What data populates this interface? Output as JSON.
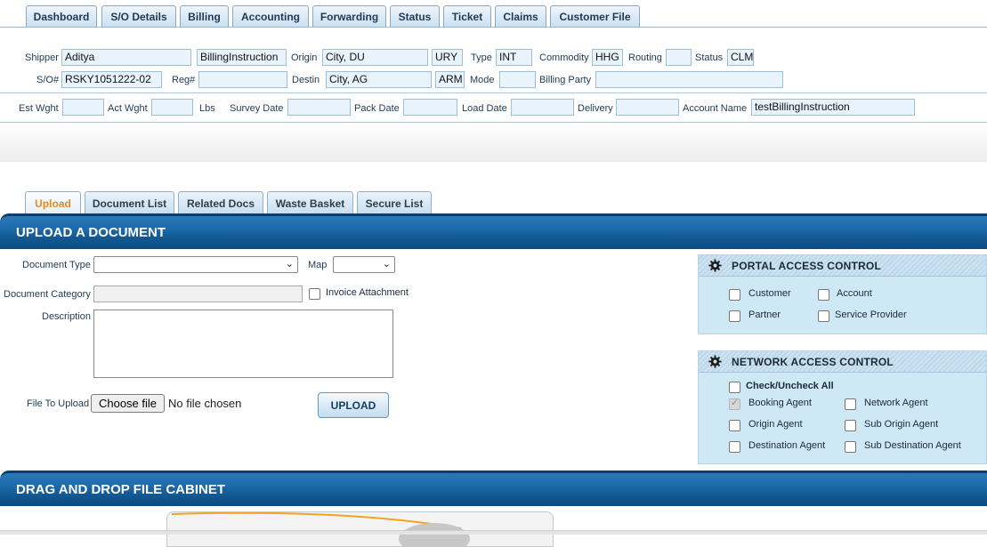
{
  "top_tabs": [
    "Dashboard",
    "S/O Details",
    "Billing",
    "Accounting",
    "Forwarding",
    "Status",
    "Ticket",
    "Claims",
    "Customer File"
  ],
  "header": {
    "shipper_label": "Shipper",
    "shipper_value": "Aditya",
    "billing_value": "BillingInstruction",
    "origin_label": "Origin",
    "origin_city": "City, DU",
    "origin_code": "URY",
    "type_label": "Type",
    "type_value": "INT",
    "commodity_label": "Commodity",
    "commodity_value": "HHG",
    "routing_label": "Routing",
    "routing_value": "",
    "status_label": "Status",
    "status_value": "CLM",
    "so_label": "S/O#",
    "so_value": "RSKY1051222-02",
    "reg_label": "Reg#",
    "reg_value": "",
    "destin_label": "Destin",
    "destin_city": "City, AG",
    "destin_code": "ARM",
    "mode_label": "Mode",
    "mode_value": "",
    "billing_party_label": "Billing Party",
    "billing_party_value": "",
    "est_wght_label": "Est Wght",
    "est_wght_value": "",
    "act_wght_label": "Act Wght",
    "act_wght_value": "",
    "lbs_label": "Lbs",
    "survey_date_label": "Survey Date",
    "survey_date_value": "",
    "pack_date_label": "Pack Date",
    "pack_date_value": "",
    "load_date_label": "Load Date",
    "load_date_value": "",
    "delivery_label": "Delivery",
    "delivery_value": "",
    "account_name_label": "Account Name",
    "account_name_value": "testBillingInstruction"
  },
  "doc_tabs": [
    "Upload",
    "Document List",
    "Related Docs",
    "Waste Basket",
    "Secure List"
  ],
  "upload_section": {
    "title": "UPLOAD A DOCUMENT",
    "document_type_label": "Document Type",
    "document_type_value": "",
    "map_label": "Map",
    "map_value": "",
    "document_category_label": "Document Category",
    "document_category_value": "",
    "invoice_attachment_label": "Invoice Attachment",
    "description_label": "Description",
    "description_value": "",
    "file_label": "File To Upload",
    "choose_file_label": "Choose file",
    "no_file_text": "No file chosen",
    "upload_button": "UPLOAD"
  },
  "portal_access": {
    "title": "PORTAL ACCESS CONTROL",
    "items": [
      "Customer",
      "Account",
      "Partner",
      "Service Provider"
    ]
  },
  "network_access": {
    "title": "NETWORK ACCESS CONTROL",
    "check_all": "Check/Uncheck All",
    "items": [
      "Booking Agent",
      "Network Agent",
      "Origin Agent",
      "Sub Origin Agent",
      "Destination Agent",
      "Sub Destination Agent"
    ]
  },
  "cabinet_section": {
    "title": "DRAG AND DROP FILE CABINET"
  },
  "colors": {
    "bar_blue": "#1d6aab",
    "panel_bg": "#cfe8f6",
    "active_tab_text": "#e8891a",
    "field_bg": "#e8f3fc"
  }
}
